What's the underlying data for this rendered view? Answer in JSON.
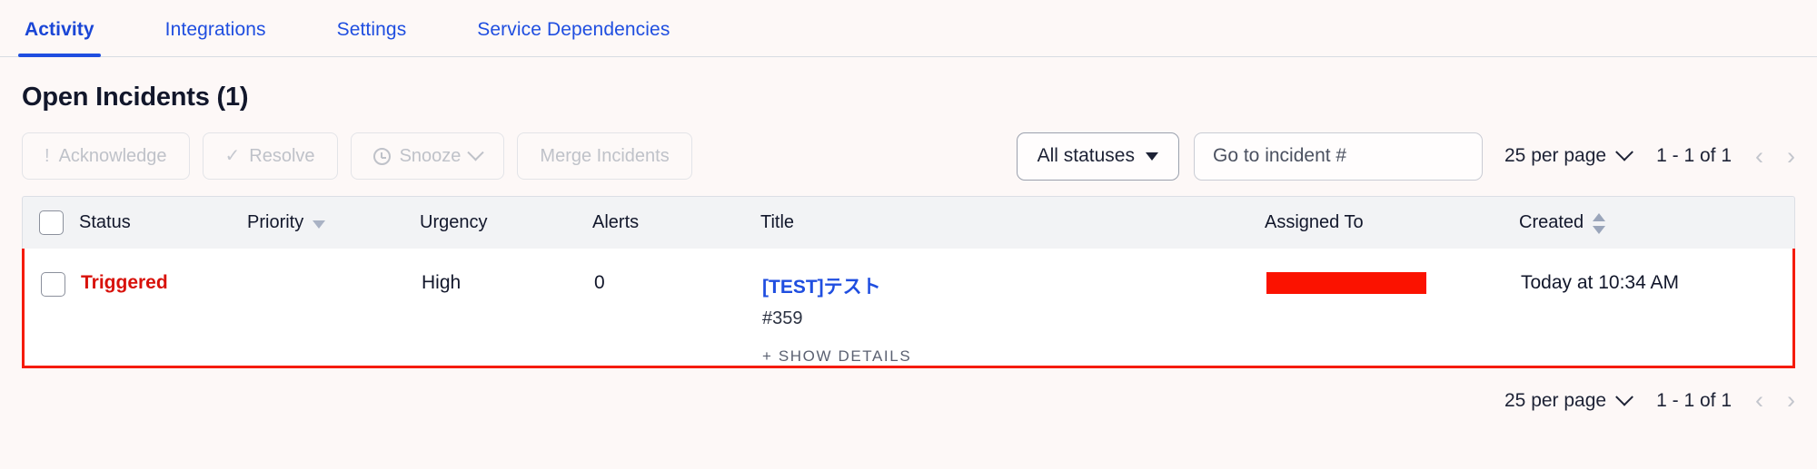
{
  "tabs": [
    {
      "label": "Activity",
      "active": true
    },
    {
      "label": "Integrations",
      "active": false
    },
    {
      "label": "Settings",
      "active": false
    },
    {
      "label": "Service Dependencies",
      "active": false
    }
  ],
  "page_title": "Open Incidents (1)",
  "toolbar": {
    "acknowledge_label": "Acknowledge",
    "acknowledge_icon": "exclamation-icon",
    "acknowledge_glyph": "!",
    "resolve_label": "Resolve",
    "resolve_icon": "check-icon",
    "resolve_glyph": "✓",
    "snooze_label": "Snooze",
    "snooze_icon": "clock-icon",
    "merge_label": "Merge Incidents",
    "status_filter_value": "All statuses",
    "goto_placeholder": "Go to incident #",
    "goto_value": ""
  },
  "pagination_top": {
    "per_page_label": "25 per page",
    "range_label": "1 - 1  of 1",
    "prev_glyph": "‹",
    "next_glyph": "›"
  },
  "pagination_bottom": {
    "per_page_label": "25 per page",
    "range_label": "1 - 1  of 1",
    "prev_glyph": "‹",
    "next_glyph": "›"
  },
  "table": {
    "columns": [
      {
        "label": "Status",
        "sort": "none"
      },
      {
        "label": "Priority",
        "sort": "desc"
      },
      {
        "label": "Urgency",
        "sort": "none"
      },
      {
        "label": "Alerts",
        "sort": "none"
      },
      {
        "label": "Title",
        "sort": "none"
      },
      {
        "label": "Assigned To",
        "sort": "none"
      },
      {
        "label": "Created",
        "sort": "both"
      }
    ],
    "rows": [
      {
        "status": "Triggered",
        "priority": "",
        "urgency": "High",
        "alerts": "0",
        "title": "[TEST]テスト",
        "incident_number": "#359",
        "show_details": "+ SHOW DETAILS",
        "assigned_to": "",
        "created": "Today at 10:34 AM",
        "highlighted": true
      }
    ]
  },
  "colors": {
    "background": "#fdf8f7",
    "link_blue": "#1f4ee0",
    "triggered_red": "#d8110a",
    "highlight_border": "#f51b08",
    "redaction_red": "#fb1200",
    "header_gray": "#f2f3f5"
  }
}
